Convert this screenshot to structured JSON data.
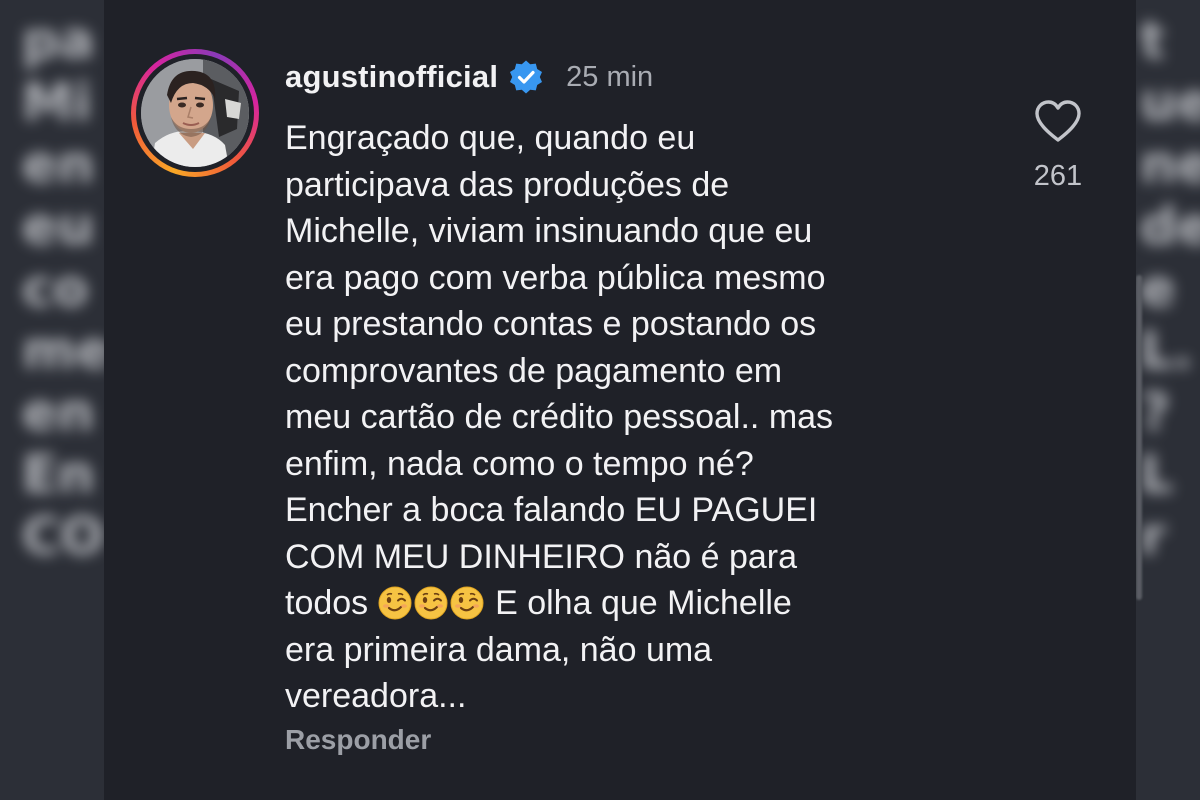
{
  "background_side_text": {
    "left": "pa\nMi\nen\neu\nco\nme\nen\nEn\nCO",
    "right": "t\nue\nne\nde\ne\nL.\n?\nL\nr"
  },
  "comment": {
    "author": {
      "username": "agustinofficial",
      "verified_icon": "verified-badge-icon",
      "avatar_ring_colors": [
        "#f9a826",
        "#f15a3a",
        "#d6249f",
        "#8a3ab9"
      ]
    },
    "timestamp": "25 min",
    "text_lines": [
      "Engraçado que, quando eu",
      "participava das produções de",
      "Michelle, viviam insinuando que eu",
      "era pago com verba pública mesmo",
      "eu prestando contas e postando os",
      "comprovantes de pagamento em",
      "meu cartão de crédito pessoal.. mas",
      "enfim, nada como o tempo né?",
      "Encher a boca falando EU PAGUEI",
      "COM MEU DINHEIRO não é para",
      "todos",
      "E olha que Michelle",
      "era primeira dama, não uma",
      "vereadora..."
    ],
    "inline_emojis": [
      "winking-face-emoji",
      "winking-face-emoji",
      "winking-face-emoji"
    ],
    "reply_label": "Responder",
    "likes": {
      "icon": "heart-outline-icon",
      "count": "261"
    }
  },
  "colors": {
    "card_background": "#1f2128",
    "text_primary": "#f2f2f4",
    "text_secondary": "#a9acb3",
    "verified_blue": "#3897f0"
  }
}
